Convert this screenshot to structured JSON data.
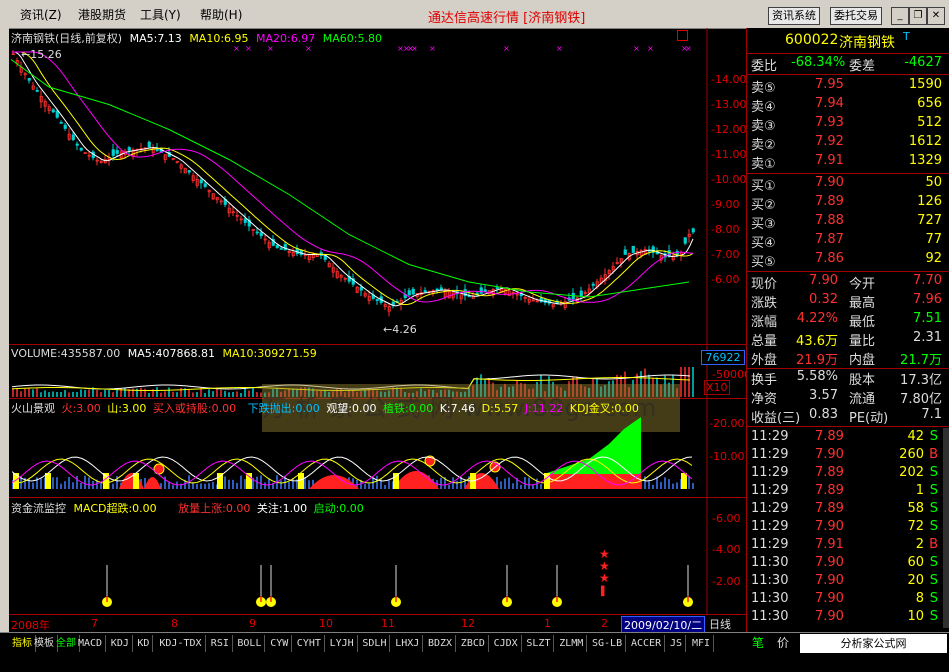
{
  "menu": [
    "资讯(Z)",
    "港股期货",
    "工具(Y)",
    "帮助(H)"
  ],
  "window_title": "通达信高速行情 [济南钢铁]",
  "buttons": {
    "news_system": "资讯系统",
    "trade": "委托交易"
  },
  "chart_header": {
    "name": "济南钢铁(日线,前复权)",
    "ma5": "MA5:7.13",
    "ma10": "MA10:6.95",
    "ma20": "MA20:6.97",
    "ma60": "MA60:5.80",
    "high_mark": "15.26",
    "low_mark": "4.26"
  },
  "price_axis": [
    "14.00",
    "13.00",
    "12.00",
    "11.00",
    "10.00",
    "9.00",
    "8.00",
    "7.00",
    "6.00"
  ],
  "volume_header": {
    "volume": "VOLUME:435587.00",
    "ma5": "MA5:407868.81",
    "ma10": "MA10:309271.59"
  },
  "volume_axis": {
    "top": "76922",
    "mid": "50000",
    "unit": "X10"
  },
  "indicator1_header": {
    "name": "火山景观",
    "huo": "火:3.00",
    "shan": "山:3.00",
    "buy": "买入或持股:0.00",
    "sell": "下跌抛出:0.00",
    "watch": "观望:0.00",
    "bottom": "植铁:0.00",
    "k": "K:7.46",
    "d": "D:5.57",
    "j": "J:11.22",
    "kdj": "KDJ金叉:0.00"
  },
  "indicator1_axis": [
    "20.00",
    "10.00"
  ],
  "indicator2_header": {
    "name": "资金流监控",
    "macd": "MACD超跌:0.00",
    "rise": "放量上涨:0.00",
    "focus": "关注:1.00",
    "start": "启动:0.00"
  },
  "indicator2_axis": [
    "6.00",
    "4.00",
    "2.00"
  ],
  "date_axis": {
    "year": "2008年",
    "months": [
      "7",
      "8",
      "9",
      "10",
      "11",
      "12",
      "1",
      "2"
    ],
    "cursor_date": "2009/02/10/二",
    "period": "日线"
  },
  "watermark": "万 析 家 公 式 网 www.88gs.com",
  "quote": {
    "code": "600022",
    "name": "济南钢铁",
    "weibi_label": "委比",
    "weibi": "-68.34%",
    "weicha_label": "委差",
    "weicha": "-4627",
    "sells": [
      {
        "label": "卖⑤",
        "price": "7.95",
        "vol": "1590"
      },
      {
        "label": "卖④",
        "price": "7.94",
        "vol": "656"
      },
      {
        "label": "卖③",
        "price": "7.93",
        "vol": "512"
      },
      {
        "label": "卖②",
        "price": "7.92",
        "vol": "1612"
      },
      {
        "label": "卖①",
        "price": "7.91",
        "vol": "1329"
      }
    ],
    "buys": [
      {
        "label": "买①",
        "price": "7.90",
        "vol": "50"
      },
      {
        "label": "买②",
        "price": "7.89",
        "vol": "126"
      },
      {
        "label": "买③",
        "price": "7.88",
        "vol": "727"
      },
      {
        "label": "买④",
        "price": "7.87",
        "vol": "77"
      },
      {
        "label": "买⑤",
        "price": "7.86",
        "vol": "92"
      }
    ],
    "stats": [
      {
        "l1": "现价",
        "v1": "7.90",
        "l2": "今开",
        "v2": "7.70"
      },
      {
        "l1": "涨跌",
        "v1": "0.32",
        "l2": "最高",
        "v2": "7.96"
      },
      {
        "l1": "涨幅",
        "v1": "4.22%",
        "l2": "最低",
        "v2": "7.51"
      },
      {
        "l1": "总量",
        "v1": "43.6万",
        "l2": "量比",
        "v2": "2.31"
      },
      {
        "l1": "外盘",
        "v1": "21.9万",
        "l2": "内盘",
        "v2": "21.7万"
      }
    ],
    "stats2": [
      {
        "l1": "换手",
        "v1": "5.58%",
        "l2": "股本",
        "v2": "17.3亿"
      },
      {
        "l1": "净资",
        "v1": "3.57",
        "l2": "流通",
        "v2": "7.80亿"
      },
      {
        "l1": "收益(三)",
        "v1": "0.83",
        "l2": "PE(动)",
        "v2": "7.1"
      }
    ],
    "ticks": [
      {
        "t": "11:29",
        "p": "7.89",
        "v": "42",
        "s": "S"
      },
      {
        "t": "11:29",
        "p": "7.90",
        "v": "260",
        "s": "B"
      },
      {
        "t": "11:29",
        "p": "7.89",
        "v": "202",
        "s": "S"
      },
      {
        "t": "11:29",
        "p": "7.89",
        "v": "1",
        "s": "S"
      },
      {
        "t": "11:29",
        "p": "7.89",
        "v": "58",
        "s": "S"
      },
      {
        "t": "11:29",
        "p": "7.90",
        "v": "72",
        "s": "S"
      },
      {
        "t": "11:29",
        "p": "7.91",
        "v": "2",
        "s": "B"
      },
      {
        "t": "11:30",
        "p": "7.90",
        "v": "60",
        "s": "S"
      },
      {
        "t": "11:30",
        "p": "7.90",
        "v": "20",
        "s": "S"
      },
      {
        "t": "11:30",
        "p": "7.90",
        "v": "8",
        "s": "S"
      },
      {
        "t": "11:30",
        "p": "7.90",
        "v": "10",
        "s": "S"
      }
    ],
    "bottom_tabs": [
      "笔",
      "价"
    ],
    "site": "分析家公式网www.88gs.com"
  },
  "tabs": [
    "指标",
    "模板",
    "全部",
    "MACD",
    "KDJ",
    "KD",
    "KDJ-TDX",
    "RSI",
    "BOLL",
    "CYW",
    "CYHT",
    "LYJH",
    "SDLH",
    "LHXJ",
    "BDZX",
    "ZBCD",
    "CJDX",
    "SLZT",
    "ZLMM",
    "SG-LB",
    "ACCER",
    "JS",
    "MFI"
  ],
  "colors": {
    "up": "#ff3030",
    "down": "#00d0d0",
    "ma5": "#ffffff",
    "ma10": "#ffff00",
    "ma20": "#ff00ff",
    "ma60": "#00ff00"
  }
}
